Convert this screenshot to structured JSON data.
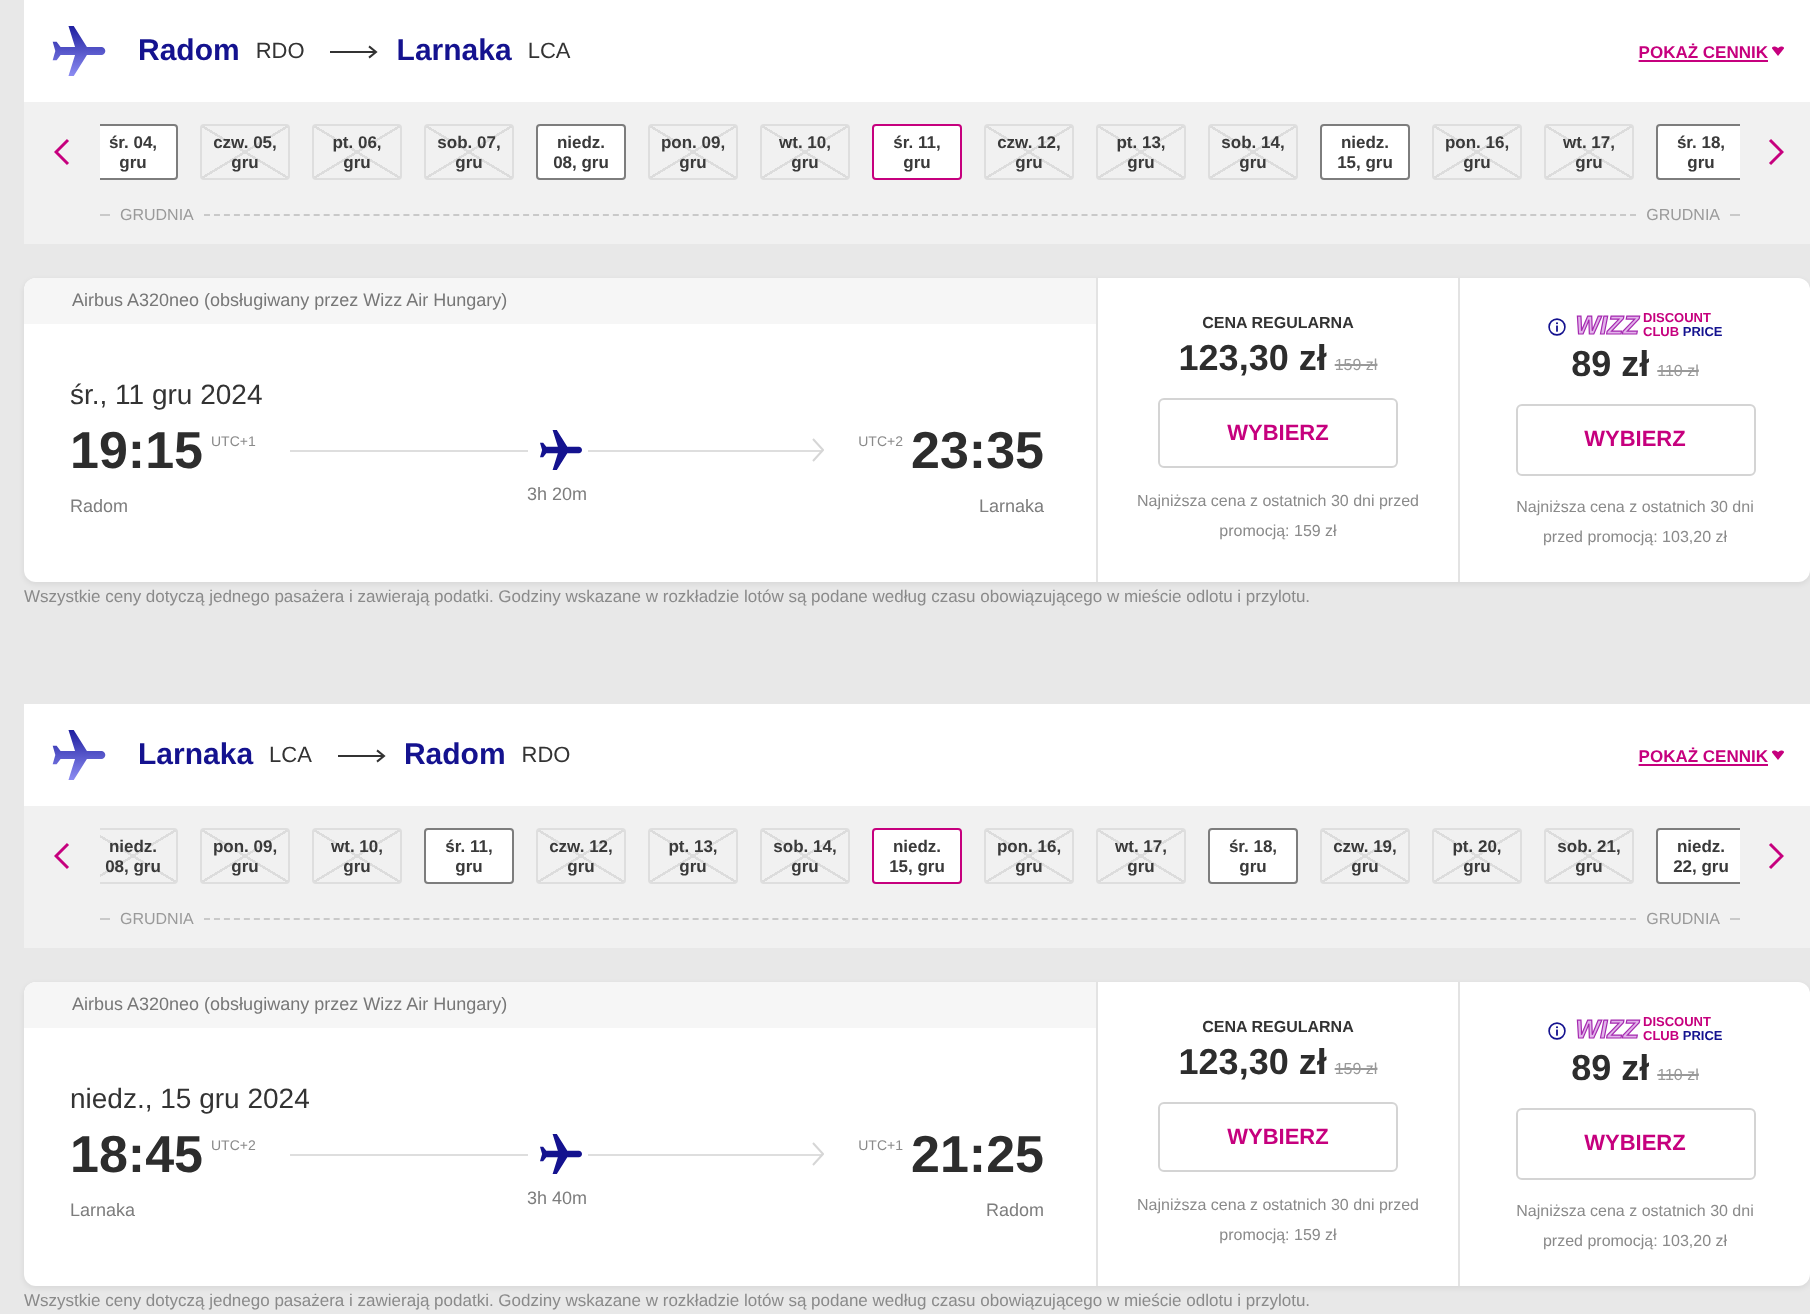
{
  "flights": [
    {
      "from": {
        "city": "Radom",
        "code": "RDO"
      },
      "to": {
        "city": "Larnaka",
        "code": "LCA"
      },
      "price_list_link": "POKAŻ CENNIK",
      "dates": [
        {
          "lines": [
            "śr. 04,",
            "gru"
          ],
          "available": true,
          "selected": false
        },
        {
          "lines": [
            "czw. 05,",
            "gru"
          ],
          "available": false,
          "selected": false
        },
        {
          "lines": [
            "pt. 06,",
            "gru"
          ],
          "available": false,
          "selected": false
        },
        {
          "lines": [
            "sob. 07,",
            "gru"
          ],
          "available": false,
          "selected": false
        },
        {
          "lines": [
            "niedz.",
            "08, gru"
          ],
          "available": true,
          "selected": false
        },
        {
          "lines": [
            "pon. 09,",
            "gru"
          ],
          "available": false,
          "selected": false
        },
        {
          "lines": [
            "wt. 10,",
            "gru"
          ],
          "available": false,
          "selected": false
        },
        {
          "lines": [
            "śr. 11,",
            "gru"
          ],
          "available": true,
          "selected": true
        },
        {
          "lines": [
            "czw. 12,",
            "gru"
          ],
          "available": false,
          "selected": false
        },
        {
          "lines": [
            "pt. 13,",
            "gru"
          ],
          "available": false,
          "selected": false
        },
        {
          "lines": [
            "sob. 14,",
            "gru"
          ],
          "available": false,
          "selected": false
        },
        {
          "lines": [
            "niedz.",
            "15, gru"
          ],
          "available": true,
          "selected": false
        },
        {
          "lines": [
            "pon. 16,",
            "gru"
          ],
          "available": false,
          "selected": false
        },
        {
          "lines": [
            "wt. 17,",
            "gru"
          ],
          "available": false,
          "selected": false
        },
        {
          "lines": [
            "śr. 18,",
            "gru"
          ],
          "available": true,
          "selected": false
        }
      ],
      "month_labels": [
        "GRUDNIA",
        "GRUDNIA"
      ],
      "aircraft": "Airbus A320neo (obsługiwany przez Wizz Air Hungary)",
      "date": "śr., 11 gru 2024",
      "departure": {
        "time": "19:15",
        "utc": "UTC+1",
        "city": "Radom"
      },
      "duration": "3h 20m",
      "arrival": {
        "time": "23:35",
        "utc": "UTC+2",
        "city": "Larnaka"
      },
      "fares": [
        {
          "kind": "regular",
          "title": "CENA REGULARNA",
          "price": "123,30 zł",
          "old_price": "159 zł",
          "button": "WYBIERZ",
          "note": "Najniższa cena z ostatnich 30 dni przed promocją: 159 zł"
        },
        {
          "kind": "club",
          "logo": {
            "brand": "WIZZ",
            "line_1": "DISCOUNT",
            "club": "CLUB",
            "price": "PRICE"
          },
          "price": "89 zł",
          "old_price": "110 zł",
          "button": "WYBIERZ",
          "note": "Najniższa cena z ostatnich 30 dni przed promocją: 103,20 zł"
        }
      ],
      "footnote": "Wszystkie ceny dotyczą jednego pasażera i zawierają podatki. Godziny wskazane w rozkładzie lotów są podane według czasu obowiązującego w mieście odlotu i przylotu."
    },
    {
      "from": {
        "city": "Larnaka",
        "code": "LCA"
      },
      "to": {
        "city": "Radom",
        "code": "RDO"
      },
      "price_list_link": "POKAŻ CENNIK",
      "dates": [
        {
          "lines": [
            "niedz.",
            "08, gru"
          ],
          "available": false,
          "selected": false
        },
        {
          "lines": [
            "pon. 09,",
            "gru"
          ],
          "available": false,
          "selected": false
        },
        {
          "lines": [
            "wt. 10,",
            "gru"
          ],
          "available": false,
          "selected": false
        },
        {
          "lines": [
            "śr. 11,",
            "gru"
          ],
          "available": true,
          "selected": false
        },
        {
          "lines": [
            "czw. 12,",
            "gru"
          ],
          "available": false,
          "selected": false
        },
        {
          "lines": [
            "pt. 13,",
            "gru"
          ],
          "available": false,
          "selected": false
        },
        {
          "lines": [
            "sob. 14,",
            "gru"
          ],
          "available": false,
          "selected": false
        },
        {
          "lines": [
            "niedz.",
            "15, gru"
          ],
          "available": true,
          "selected": true
        },
        {
          "lines": [
            "pon. 16,",
            "gru"
          ],
          "available": false,
          "selected": false
        },
        {
          "lines": [
            "wt. 17,",
            "gru"
          ],
          "available": false,
          "selected": false
        },
        {
          "lines": [
            "śr. 18,",
            "gru"
          ],
          "available": true,
          "selected": false
        },
        {
          "lines": [
            "czw. 19,",
            "gru"
          ],
          "available": false,
          "selected": false
        },
        {
          "lines": [
            "pt. 20,",
            "gru"
          ],
          "available": false,
          "selected": false
        },
        {
          "lines": [
            "sob. 21,",
            "gru"
          ],
          "available": false,
          "selected": false
        },
        {
          "lines": [
            "niedz.",
            "22, gru"
          ],
          "available": true,
          "selected": false
        }
      ],
      "month_labels": [
        "GRUDNIA",
        "GRUDNIA"
      ],
      "aircraft": "Airbus A320neo (obsługiwany przez Wizz Air Hungary)",
      "date": "niedz., 15 gru 2024",
      "departure": {
        "time": "18:45",
        "utc": "UTC+2",
        "city": "Larnaka"
      },
      "duration": "3h 40m",
      "arrival": {
        "time": "21:25",
        "utc": "UTC+1",
        "city": "Radom"
      },
      "fares": [
        {
          "kind": "regular",
          "title": "CENA REGULARNA",
          "price": "123,30 zł",
          "old_price": "159 zł",
          "button": "WYBIERZ",
          "note": "Najniższa cena z ostatnich 30 dni przed promocją: 159 zł"
        },
        {
          "kind": "club",
          "logo": {
            "brand": "WIZZ",
            "line_1": "DISCOUNT",
            "club": "CLUB",
            "price": "PRICE"
          },
          "price": "89 zł",
          "old_price": "110 zł",
          "button": "WYBIERZ",
          "note": "Najniższa cena z ostatnich 30 dni przed promocją: 103,20 zł"
        }
      ],
      "footnote": "Wszystkie ceny dotyczą jednego pasażera i zawierają podatki. Godziny wskazane w rozkładzie lotów są podane według czasu obowiązującego w mieście odlotu i przylotu."
    }
  ]
}
